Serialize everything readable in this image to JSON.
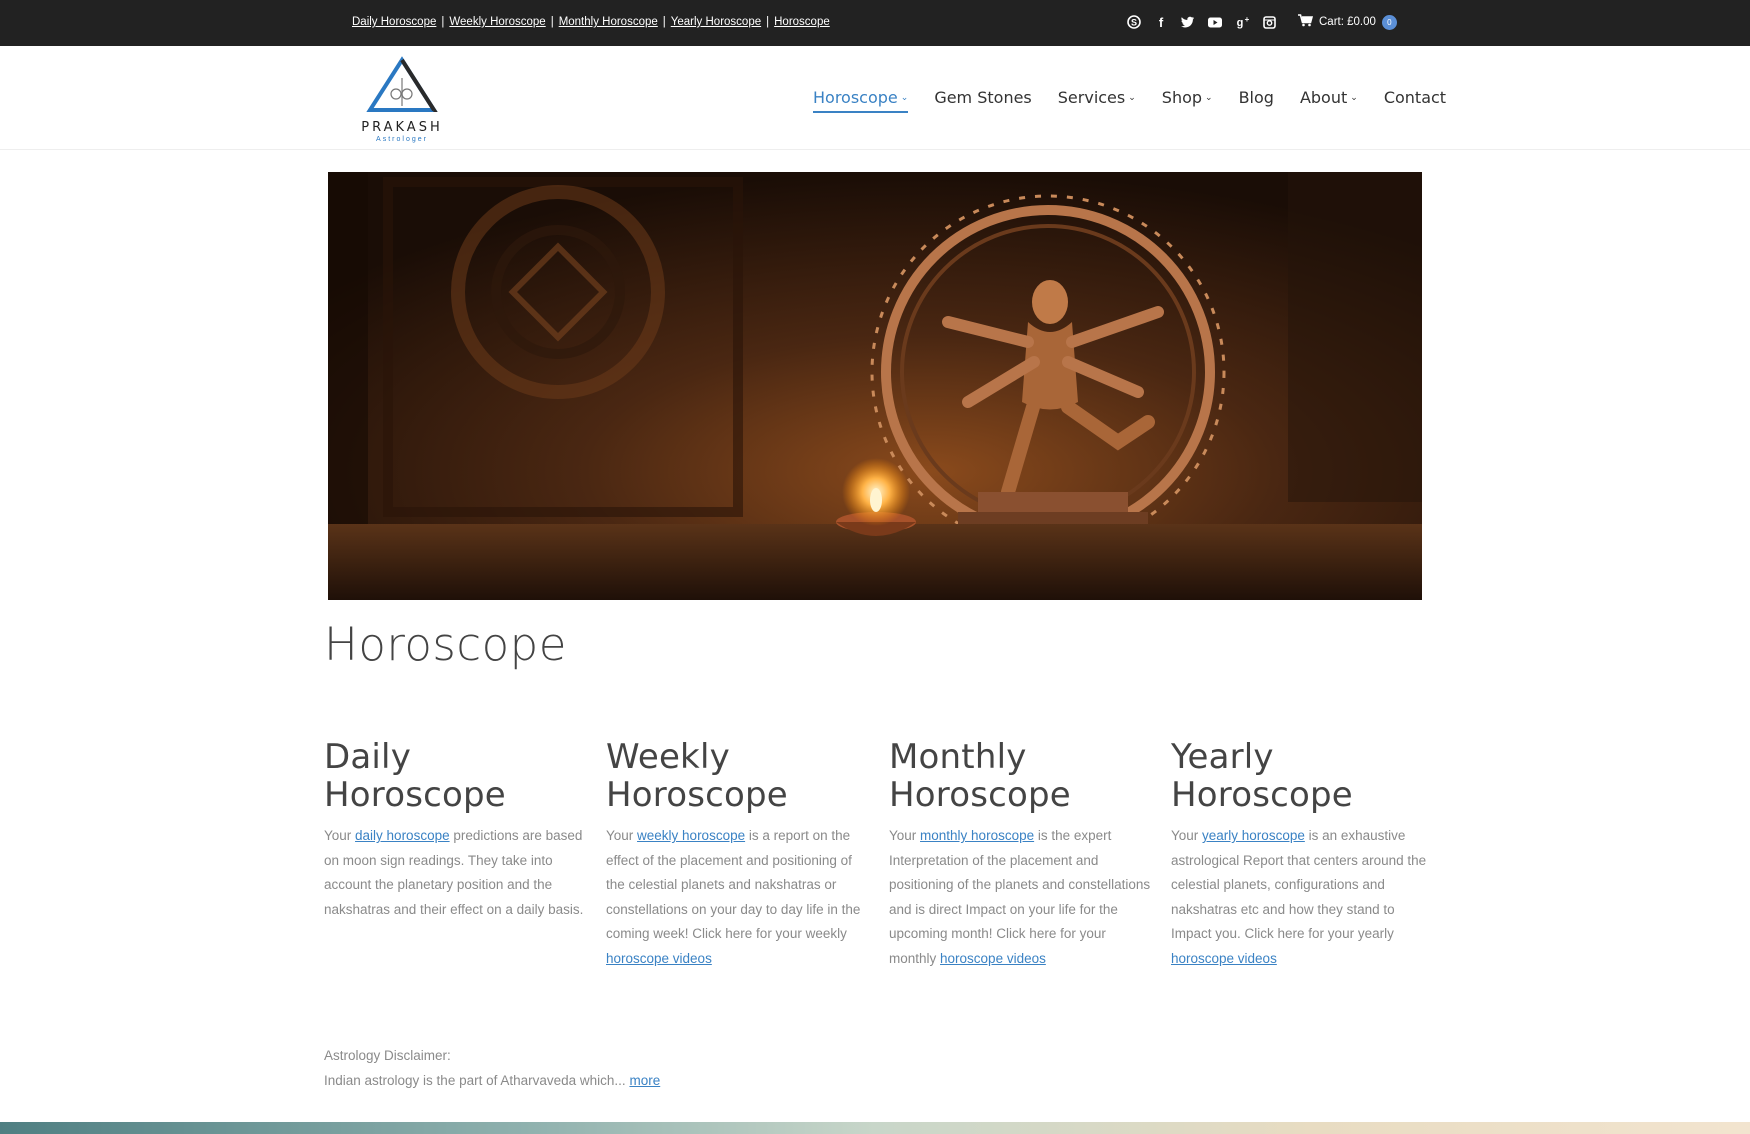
{
  "topbar": {
    "links": [
      "Daily Horoscope",
      "Weekly Horoscope",
      "Monthly Horoscope",
      "Yearly Horoscope",
      "Horoscope"
    ],
    "separator": "|",
    "social_icons": [
      "skype-icon",
      "facebook-icon",
      "twitter-icon",
      "youtube-icon",
      "google-plus-icon",
      "instagram-icon"
    ],
    "cart_label": "Cart: £0.00",
    "cart_count": "0"
  },
  "header": {
    "logo_text": "PRAKASH",
    "logo_subtext": "Astrologer",
    "nav": [
      {
        "label": "Horoscope",
        "dropdown": true,
        "active": true
      },
      {
        "label": "Gem Stones",
        "dropdown": false
      },
      {
        "label": "Services",
        "dropdown": true
      },
      {
        "label": "Shop",
        "dropdown": true
      },
      {
        "label": "Blog",
        "dropdown": false
      },
      {
        "label": "About",
        "dropdown": true
      },
      {
        "label": "Contact",
        "dropdown": false
      }
    ]
  },
  "main": {
    "title": "Horoscope",
    "columns": [
      {
        "heading": "Daily Horoscope",
        "pre": "Your ",
        "link": "daily horoscope",
        "post": " predictions are based on moon sign readings. They take into account the planetary position and the nakshatras and their effect on a daily basis.",
        "tail_link": ""
      },
      {
        "heading": "Weekly Horoscope",
        "pre": "Your ",
        "link": "weekly horoscope",
        "post": " is a report on the effect of the placement and positioning of the celestial planets and nakshatras or constellations on your day to day life in the coming week! Click here for your weekly ",
        "tail_link": "horoscope videos"
      },
      {
        "heading": "Monthly Horoscope",
        "pre": "Your ",
        "link": "monthly horoscope",
        "post": " is the expert Interpretation of the placement and positioning of the planets and constellations and is direct Impact on your life for the upcoming month! Click here for your monthly ",
        "tail_link": "horoscope videos"
      },
      {
        "heading": "Yearly Horoscope",
        "pre": "Your ",
        "link": "yearly horoscope",
        "post": " is an exhaustive astrological Report that centers around the celestial planets, configurations and nakshatras etc and how they stand to Impact you. Click here for your yearly ",
        "tail_link": "horoscope videos"
      }
    ],
    "disclaimer_label": "Astrology Disclaimer:",
    "disclaimer_text": "Indian astrology is the part of Atharvaveda which...",
    "disclaimer_more": "more"
  },
  "colors": {
    "topbar_bg": "#222222",
    "accent": "#3a82c4",
    "body_text": "#8a8a8a",
    "heading_text": "#444444"
  }
}
